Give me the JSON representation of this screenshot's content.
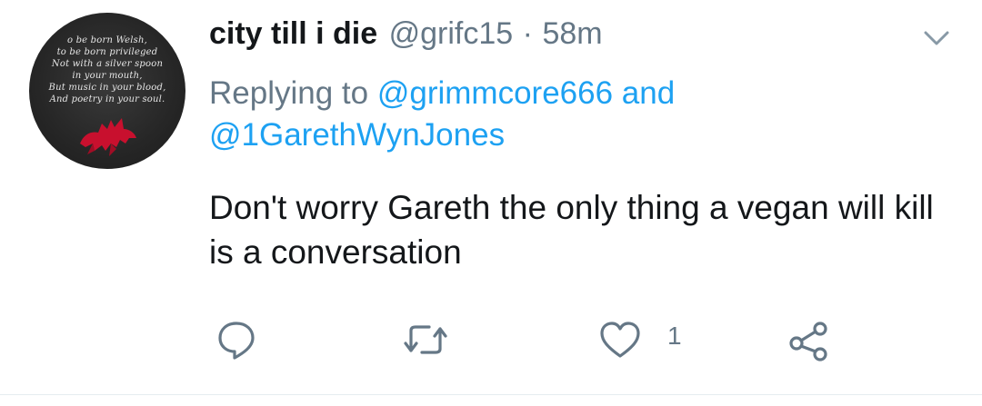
{
  "author": {
    "display_name": "city till i die",
    "handle": "@grifc15",
    "separator": "·",
    "time": "58m"
  },
  "avatar": {
    "poem_lines": [
      "o be born Welsh,",
      "to be born privileged",
      "Not with a silver spoon",
      "in your mouth,",
      "But music in your blood,",
      "And poetry in your soul."
    ]
  },
  "reply": {
    "prefix": "Replying to",
    "mention1": "@grimmcore666",
    "conjunction": "and",
    "mention2": "@1GarethWynJones"
  },
  "body": "Don't worry Gareth the only thing a vegan will kill is a conversation",
  "actions": {
    "like_count": "1",
    "icons": [
      "reply-icon",
      "retweet-icon",
      "like-icon",
      "share-icon"
    ]
  },
  "colors": {
    "text": "#14171a",
    "secondary": "#657786",
    "link": "#1da1f2",
    "dragon": "#c8102e"
  }
}
